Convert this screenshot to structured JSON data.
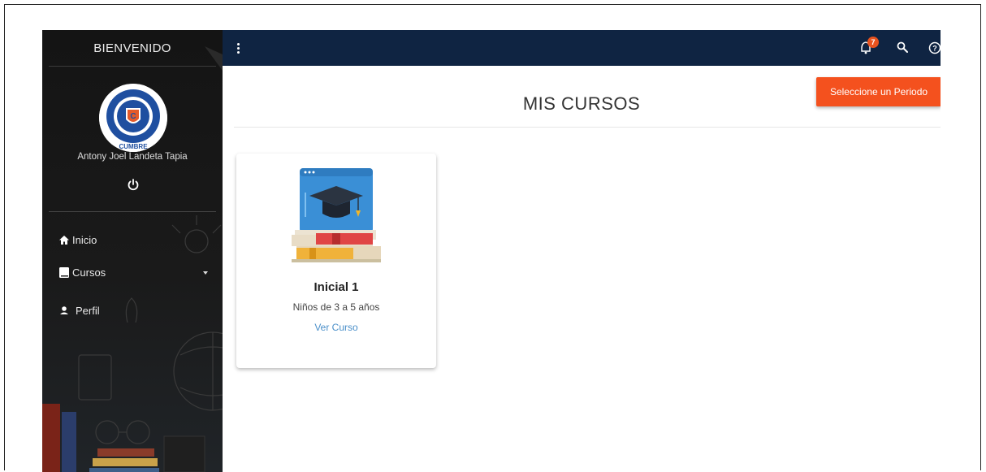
{
  "sidebar": {
    "title": "BIENVENIDO",
    "user_name": "Antony Joel Landeta Tapia",
    "logo_text": "CUMBRE",
    "items": [
      {
        "label": "Inicio",
        "icon": "home-icon"
      },
      {
        "label": "Cursos",
        "icon": "book-icon"
      },
      {
        "label": "Perfil",
        "icon": "user-icon"
      }
    ]
  },
  "topbar": {
    "notification_count": "7",
    "icons": [
      "menu-dots-icon",
      "bell-icon",
      "search-icon",
      "help-icon"
    ]
  },
  "main": {
    "page_title": "MIS CURSOS",
    "period_button": "Seleccione un Periodo",
    "courses": [
      {
        "title": "Inicial 1",
        "subtitle": "Niños de 3 a 5 años",
        "link": "Ver Curso"
      }
    ]
  },
  "colors": {
    "topbar": "#0f2442",
    "accent_button": "#f4511e",
    "badge": "#e8531f",
    "link": "#4a8fc9"
  }
}
